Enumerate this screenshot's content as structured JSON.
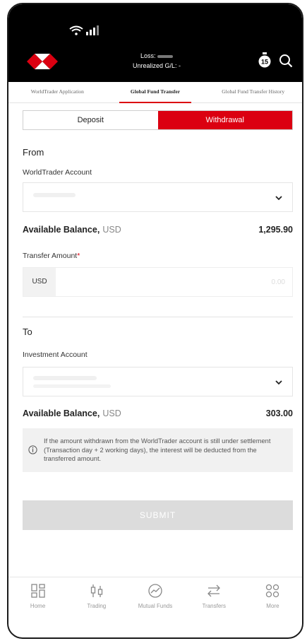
{
  "header": {
    "loss_label": "Loss:",
    "unrealized_label": "Unrealized G/L: -",
    "timer_badge": "15",
    "brand_color": "#db0011"
  },
  "tabs": [
    {
      "label": "WorldTrader Application"
    },
    {
      "label": "Global Fund Transfer",
      "active": true
    },
    {
      "label": "Global Fund Transfer History"
    }
  ],
  "toggle": {
    "deposit": "Deposit",
    "withdrawal": "Withdrawal",
    "selected": "Withdrawal"
  },
  "from": {
    "heading": "From",
    "account_label": "WorldTrader Account",
    "balance_label": "Available Balance,",
    "balance_currency": "USD",
    "balance_value": "1,295.90"
  },
  "transfer": {
    "label": "Transfer Amount",
    "required_mark": "*",
    "currency": "USD",
    "placeholder": "0.00"
  },
  "to": {
    "heading": "To",
    "account_label": "Investment Account",
    "balance_label": "Available Balance,",
    "balance_currency": "USD",
    "balance_value": "303.00"
  },
  "notice": {
    "text": "If the amount withdrawn from the WorldTrader account is still under settlement (Transaction day + 2 working days), the interest will be deducted from the transferred amount."
  },
  "submit_label": "SUBMIT",
  "bottom_nav": [
    {
      "label": "Home",
      "icon": "home-grid-icon"
    },
    {
      "label": "Trading",
      "icon": "candlestick-icon"
    },
    {
      "label": "Mutual Funds",
      "icon": "fund-chart-icon"
    },
    {
      "label": "Transfers",
      "icon": "transfer-arrows-icon"
    },
    {
      "label": "More",
      "icon": "more-circles-icon"
    }
  ]
}
